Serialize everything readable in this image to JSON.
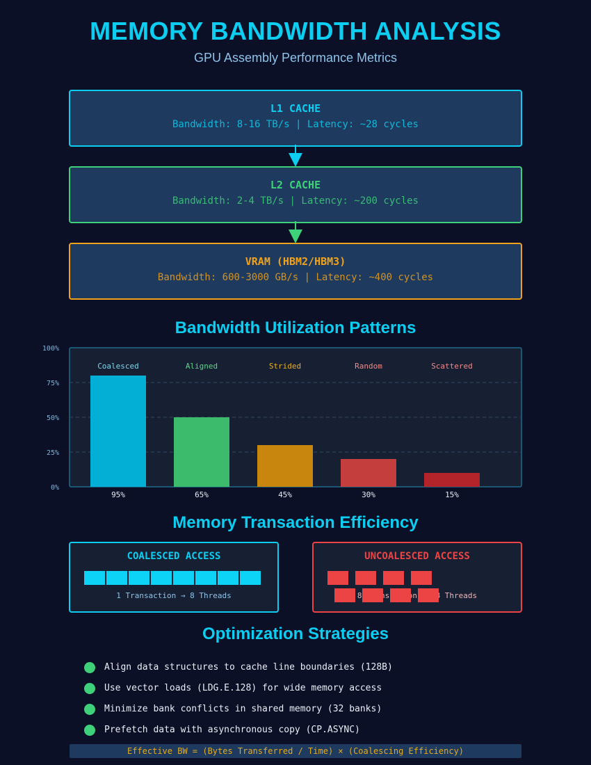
{
  "header": {
    "title": "MEMORY BANDWIDTH ANALYSIS",
    "subtitle": "GPU Assembly Performance Metrics"
  },
  "hierarchy": [
    {
      "name": "L1 CACHE",
      "desc": "Bandwidth: 8-16 TB/s | Latency: ~28 cycles",
      "color": "#0dcdf0"
    },
    {
      "name": "L2 CACHE",
      "desc": "Bandwidth: 2-4 TB/s | Latency: ~200 cycles",
      "color": "#3ed17a"
    },
    {
      "name": "VRAM (HBM2/HBM3)",
      "desc": "Bandwidth: 600-3000 GB/s | Latency: ~400 cycles",
      "color": "#f0a21a"
    }
  ],
  "utilization": {
    "heading": "Bandwidth Utilization Patterns"
  },
  "chart_data": {
    "type": "bar",
    "title": "Bandwidth Utilization Patterns",
    "categories": [
      "Coalesced",
      "Aligned",
      "Strided",
      "Random",
      "Scattered"
    ],
    "value_labels": [
      "95%",
      "65%",
      "45%",
      "30%",
      "15%"
    ],
    "bar_heights": [
      80,
      50,
      30,
      20,
      10
    ],
    "category_colors": [
      "#7fd4ea",
      "#5fd38a",
      "#e6b020",
      "#f08a8a",
      "#f08a8a"
    ],
    "bar_colors": [
      "#04afd6",
      "#3cbb6c",
      "#c8860f",
      "#c53e3e",
      "#b3232a"
    ],
    "y_ticks": [
      "100%",
      "75%",
      "50%",
      "25%",
      "0%"
    ],
    "y_tick_values": [
      100,
      75,
      50,
      25,
      0
    ],
    "ylim": [
      0,
      100
    ],
    "grid": true
  },
  "transactions": {
    "heading": "Memory Transaction Efficiency",
    "coalesced": {
      "title": "COALESCED ACCESS",
      "caption": "1 Transaction → 8 Threads",
      "color": "#0dcdf0",
      "cells": 8
    },
    "uncoalesced": {
      "title": "UNCOALESCED ACCESS",
      "caption": "8 Transactions → 8 Threads",
      "color": "#ec4444",
      "cells": 8
    }
  },
  "strategies": {
    "heading": "Optimization Strategies",
    "items": [
      "Align data structures to cache line boundaries (128B)",
      "Use vector loads (LDG.E.128) for wide memory access",
      "Minimize bank conflicts in shared memory (32 banks)",
      "Prefetch data with asynchronous copy (CP.ASYNC)"
    ],
    "formula": "Effective BW = (Bytes Transferred / Time) × (Coalescing Efficiency)"
  }
}
